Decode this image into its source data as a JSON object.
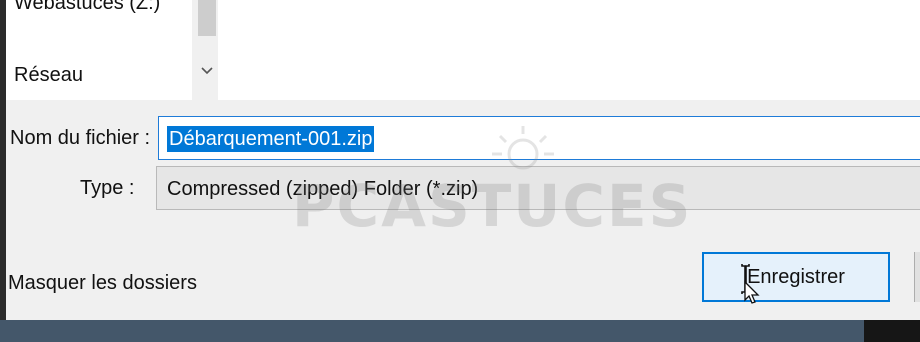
{
  "navigation": {
    "drive_label": "Webastuces (Z:)",
    "network_label": "Réseau"
  },
  "form": {
    "filename_label": "Nom du fichier :",
    "filename_value": "Débarquement-001.zip",
    "type_label": "Type :",
    "type_value": "Compressed (zipped) Folder (*.zip)"
  },
  "footer": {
    "hide_folders_label": "Masquer les dossiers",
    "save_label": "Enregistrer"
  },
  "watermark": {
    "text": "PCASTUCES"
  },
  "colors": {
    "selection": "#0078d7",
    "button_focus": "#0078d7",
    "dialog_bg": "#f0f0f0"
  }
}
